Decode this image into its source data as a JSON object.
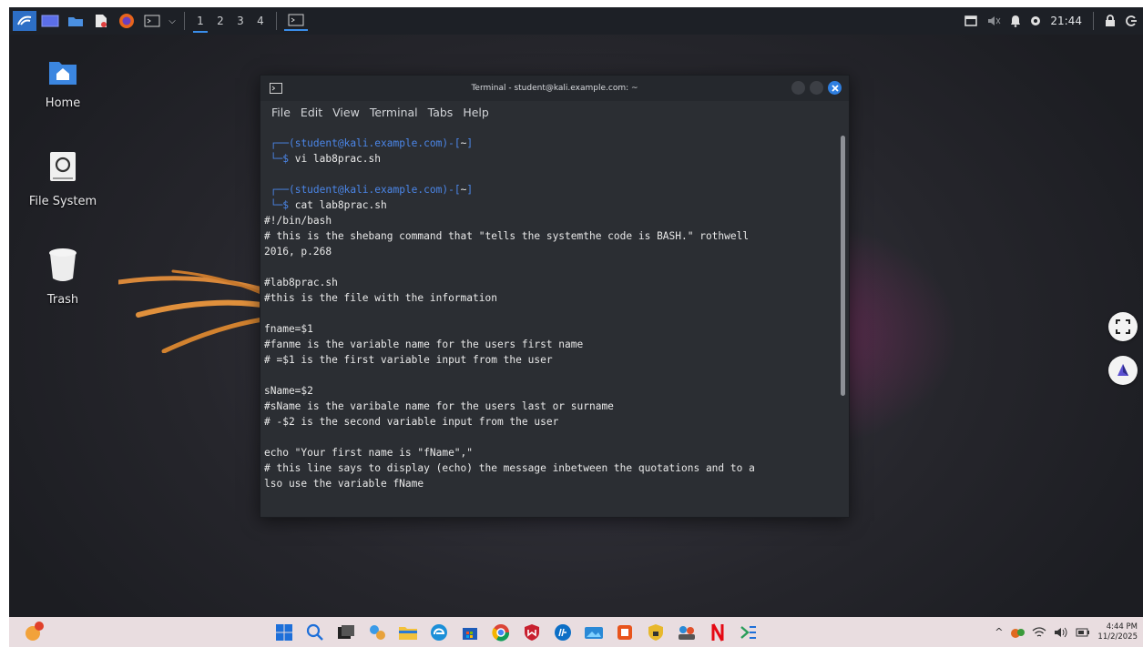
{
  "top_panel": {
    "workspaces": [
      "1",
      "2",
      "3",
      "4"
    ],
    "active_workspace": "1",
    "clock": "21:44"
  },
  "desktop": {
    "icons": [
      {
        "label": "Home",
        "icon": "home-folder-icon"
      },
      {
        "label": "File System",
        "icon": "drive-icon"
      },
      {
        "label": "Trash",
        "icon": "trash-icon"
      }
    ]
  },
  "terminal": {
    "title": "Terminal - student@kali.example.com: ~",
    "menu": [
      "File",
      "Edit",
      "View",
      "Terminal",
      "Tabs",
      "Help"
    ],
    "prompt_user": "student@kali.example.com",
    "prompt_dir": "~",
    "commands": [
      "vi lab8prac.sh",
      "cat lab8prac.sh"
    ],
    "output_lines": [
      "#!/bin/bash",
      "# this is the shebang command that \"tells the systemthe code is BASH.\" rothwell",
      "2016, p.268",
      "",
      "#lab8prac.sh",
      "#this is the file with the information",
      "",
      "fname=$1",
      "#fanme is the variable name for the users first name",
      "# =$1 is the first variable input from the user",
      "",
      "sName=$2",
      "#sName is the varibale name for the users last or surname",
      "# -$2 is the second variable input from the user",
      "",
      "echo \"Your first name is \"fName\",\"",
      "# this line says to display (echo) the message inbetween the quotations and to a",
      "lso use the variable fName"
    ]
  },
  "taskbar": {
    "time": "4:44 PM",
    "date": "11/2/2025"
  },
  "colors": {
    "prompt_blue": "#4b86e8",
    "panel_bg": "#1d2026",
    "terminal_bg": "#2b2e33",
    "taskbar_bg": "#e9dde0"
  }
}
